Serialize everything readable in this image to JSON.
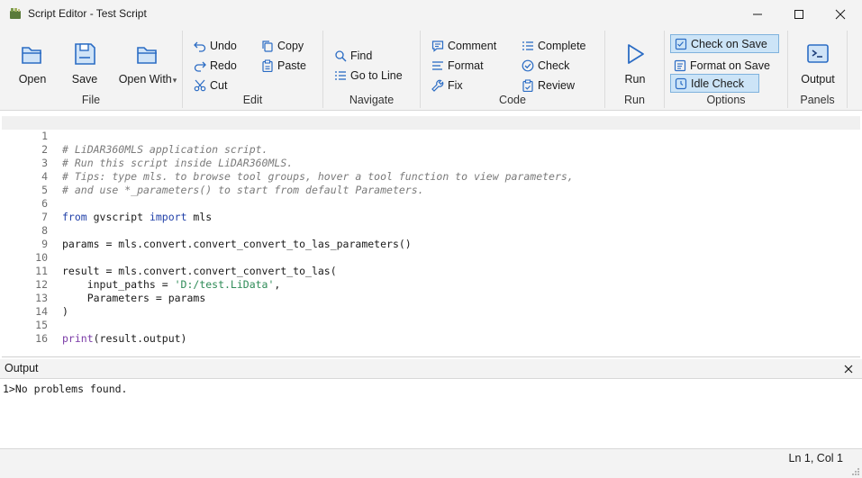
{
  "window": {
    "title": "Script Editor - Test Script"
  },
  "ribbon": {
    "file": {
      "label": "File",
      "open": "Open",
      "save": "Save",
      "open_with": "Open With"
    },
    "edit": {
      "label": "Edit",
      "undo": "Undo",
      "redo": "Redo",
      "cut": "Cut",
      "copy": "Copy",
      "paste": "Paste"
    },
    "navigate": {
      "label": "Navigate",
      "find": "Find",
      "go_to_line": "Go to Line"
    },
    "code": {
      "label": "Code",
      "comment": "Comment",
      "format": "Format",
      "fix": "Fix",
      "complete": "Complete",
      "check": "Check",
      "review": "Review"
    },
    "run": {
      "label": "Run",
      "run": "Run"
    },
    "options": {
      "label": "Options",
      "check_on_save": "Check on Save",
      "format_on_save": "Format on Save",
      "idle_check": "Idle Check"
    },
    "panels": {
      "label": "Panels",
      "output": "Output"
    }
  },
  "editor": {
    "lines": [
      {
        "n": "1",
        "text": "# LiDAR360MLS application script."
      },
      {
        "n": "2",
        "text": "# Run this script inside LiDAR360MLS."
      },
      {
        "n": "3",
        "text": "# Tips: type mls. to browse tool groups, hover a tool function to view parameters,"
      },
      {
        "n": "4",
        "text": "# and use *_parameters() to start from default Parameters."
      },
      {
        "n": "5",
        "text": ""
      },
      {
        "n": "6",
        "text": "from gvscript import mls"
      },
      {
        "n": "7",
        "text": ""
      },
      {
        "n": "8",
        "text": "params = mls.convert.convert_convert_to_las_parameters()"
      },
      {
        "n": "9",
        "text": ""
      },
      {
        "n": "10",
        "text": "result = mls.convert.convert_convert_to_las("
      },
      {
        "n": "11",
        "text": "    input_paths = 'D:/test.LiData',"
      },
      {
        "n": "12",
        "text": "    Parameters = params"
      },
      {
        "n": "13",
        "text": ")"
      },
      {
        "n": "14",
        "text": ""
      },
      {
        "n": "15",
        "text": "print(result.output)"
      },
      {
        "n": "16",
        "text": ""
      }
    ]
  },
  "output": {
    "title": "Output",
    "lines": [
      "1>No problems found."
    ]
  },
  "status": {
    "position": "Ln 1, Col 1"
  },
  "icons": {
    "app": "app-icon",
    "minimize": "minimize-icon",
    "maximize": "maximize-icon",
    "close": "close-icon"
  },
  "colors": {
    "accent": "#2b6cc4",
    "toggle_on_bg": "#cce4f7",
    "comment": "#7a7a7a",
    "keyword": "#1f3fa8",
    "string": "#2e8b57"
  }
}
